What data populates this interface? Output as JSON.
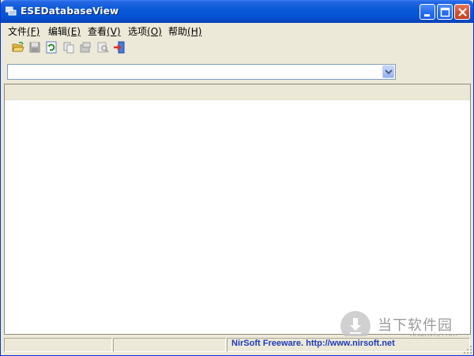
{
  "window": {
    "title": "ESEDatabaseView",
    "controls": [
      "minimize",
      "maximize",
      "close"
    ]
  },
  "menu": [
    {
      "label": "文件",
      "accel": "(F)"
    },
    {
      "label": "编辑",
      "accel": "(E)"
    },
    {
      "label": "查看",
      "accel": "(V)"
    },
    {
      "label": "选项",
      "accel": "(O)"
    },
    {
      "label": "帮助",
      "accel": "(H)"
    }
  ],
  "toolbar": {
    "icons": [
      "open-folder-icon",
      "save-icon",
      "refresh-icon",
      "copy-icon",
      "properties-icon",
      "find-icon",
      "exit-icon"
    ]
  },
  "combo": {
    "value": ""
  },
  "status": {
    "pane1": "",
    "pane2": "",
    "link": "NirSoft Freeware.  http://www.nirsoft.net"
  },
  "watermark": {
    "text": "当下软件园",
    "sub": "downxia.com"
  },
  "colors": {
    "titlebar": "#0a5ad6",
    "chrome": "#ece9d8",
    "link": "#1f3bb8"
  }
}
